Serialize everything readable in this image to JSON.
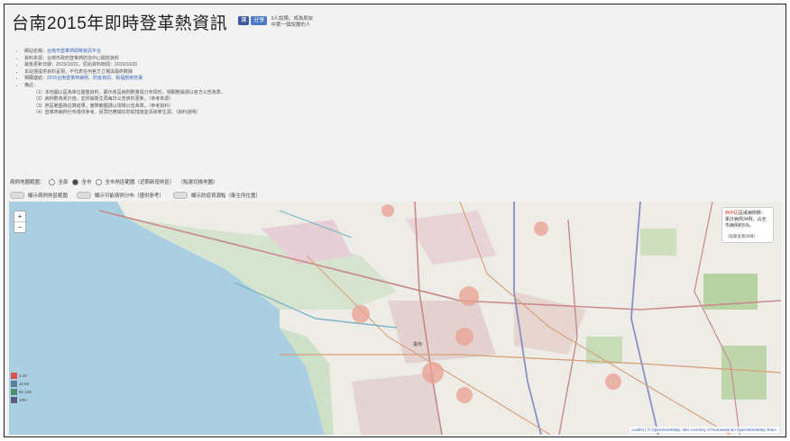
{
  "header": {
    "title": "台南2015年即時登革熱資訊",
    "badges": [
      "讚",
      "分享"
    ],
    "counts": [
      "3人說讚。成為朋友",
      "中第一個說讚的人"
    ]
  },
  "info": {
    "items": [
      {
        "label": "網站名稱：",
        "value": "台南市登革熱即時資訊平台",
        "link": true
      },
      {
        "label": "資料來源：",
        "value": "台南市政府登革熱防治中心開放資料",
        "link": false
      },
      {
        "label": "最後更新日期：",
        "value": "2015/10/21，原始資料時間：2015/10/20",
        "link": false
      },
      {
        "label": "本站僅提供資料呈現，",
        "value": "不代表任何官方立場與最終數據",
        "link": false
      },
      {
        "label": "相關連結：",
        "value": "2015台南登革熱病例、防疫資訊、衛福部疾管署",
        "link": true
      },
      {
        "label": "備註：",
        "value": "",
        "link": false
      }
    ],
    "notes": [
      "（1）本地圖以區為單位彙整資料，顯示各區病例數量與分布情形，相關數據請以官方公告為準。",
      "（2）病例數為累計值，並依據衛生局每日公告資料更新。（參考來源）",
      "（3）熱區範圍為估算結果，實際範圍請以現場公告為準。（參考資料）",
      "（4）登革熱病例分布僅供參考，民眾仍應做好防蚊措施並清除孳生源。（資料說明）"
    ]
  },
  "filters": {
    "label": "病例地圖範圍：",
    "options": [
      "全部",
      "全市",
      "全市熱區範圍（近期新增熱區）"
    ],
    "selected_index": 1,
    "note": "（點選切換地圖）"
  },
  "toggles": [
    "顯示病例熱區範圍",
    "顯示可能病例分布（僅供參考）",
    "顯示防疫資源點（衛生所位置）"
  ],
  "map": {
    "zoom_in": "+",
    "zoom_out": "−",
    "infobox": {
      "highlight": "西中區",
      "text": "區域病例數：累計病例34例，占全市病例約5%。",
      "small": "（點擊查看詳細）"
    },
    "legend": [
      {
        "label": "1-10",
        "color": "#d9534f"
      },
      {
        "label": "11-50",
        "color": "#5c7c9a"
      },
      {
        "label": "51-100",
        "color": "#4a8f6e"
      },
      {
        "label": "100+",
        "color": "#5c5c80"
      }
    ],
    "attribution": "Leaflet | © OpenStreetMap, tiles courtesy of Humanitarian OpenStreetMap Team",
    "place_label": "臺南"
  }
}
